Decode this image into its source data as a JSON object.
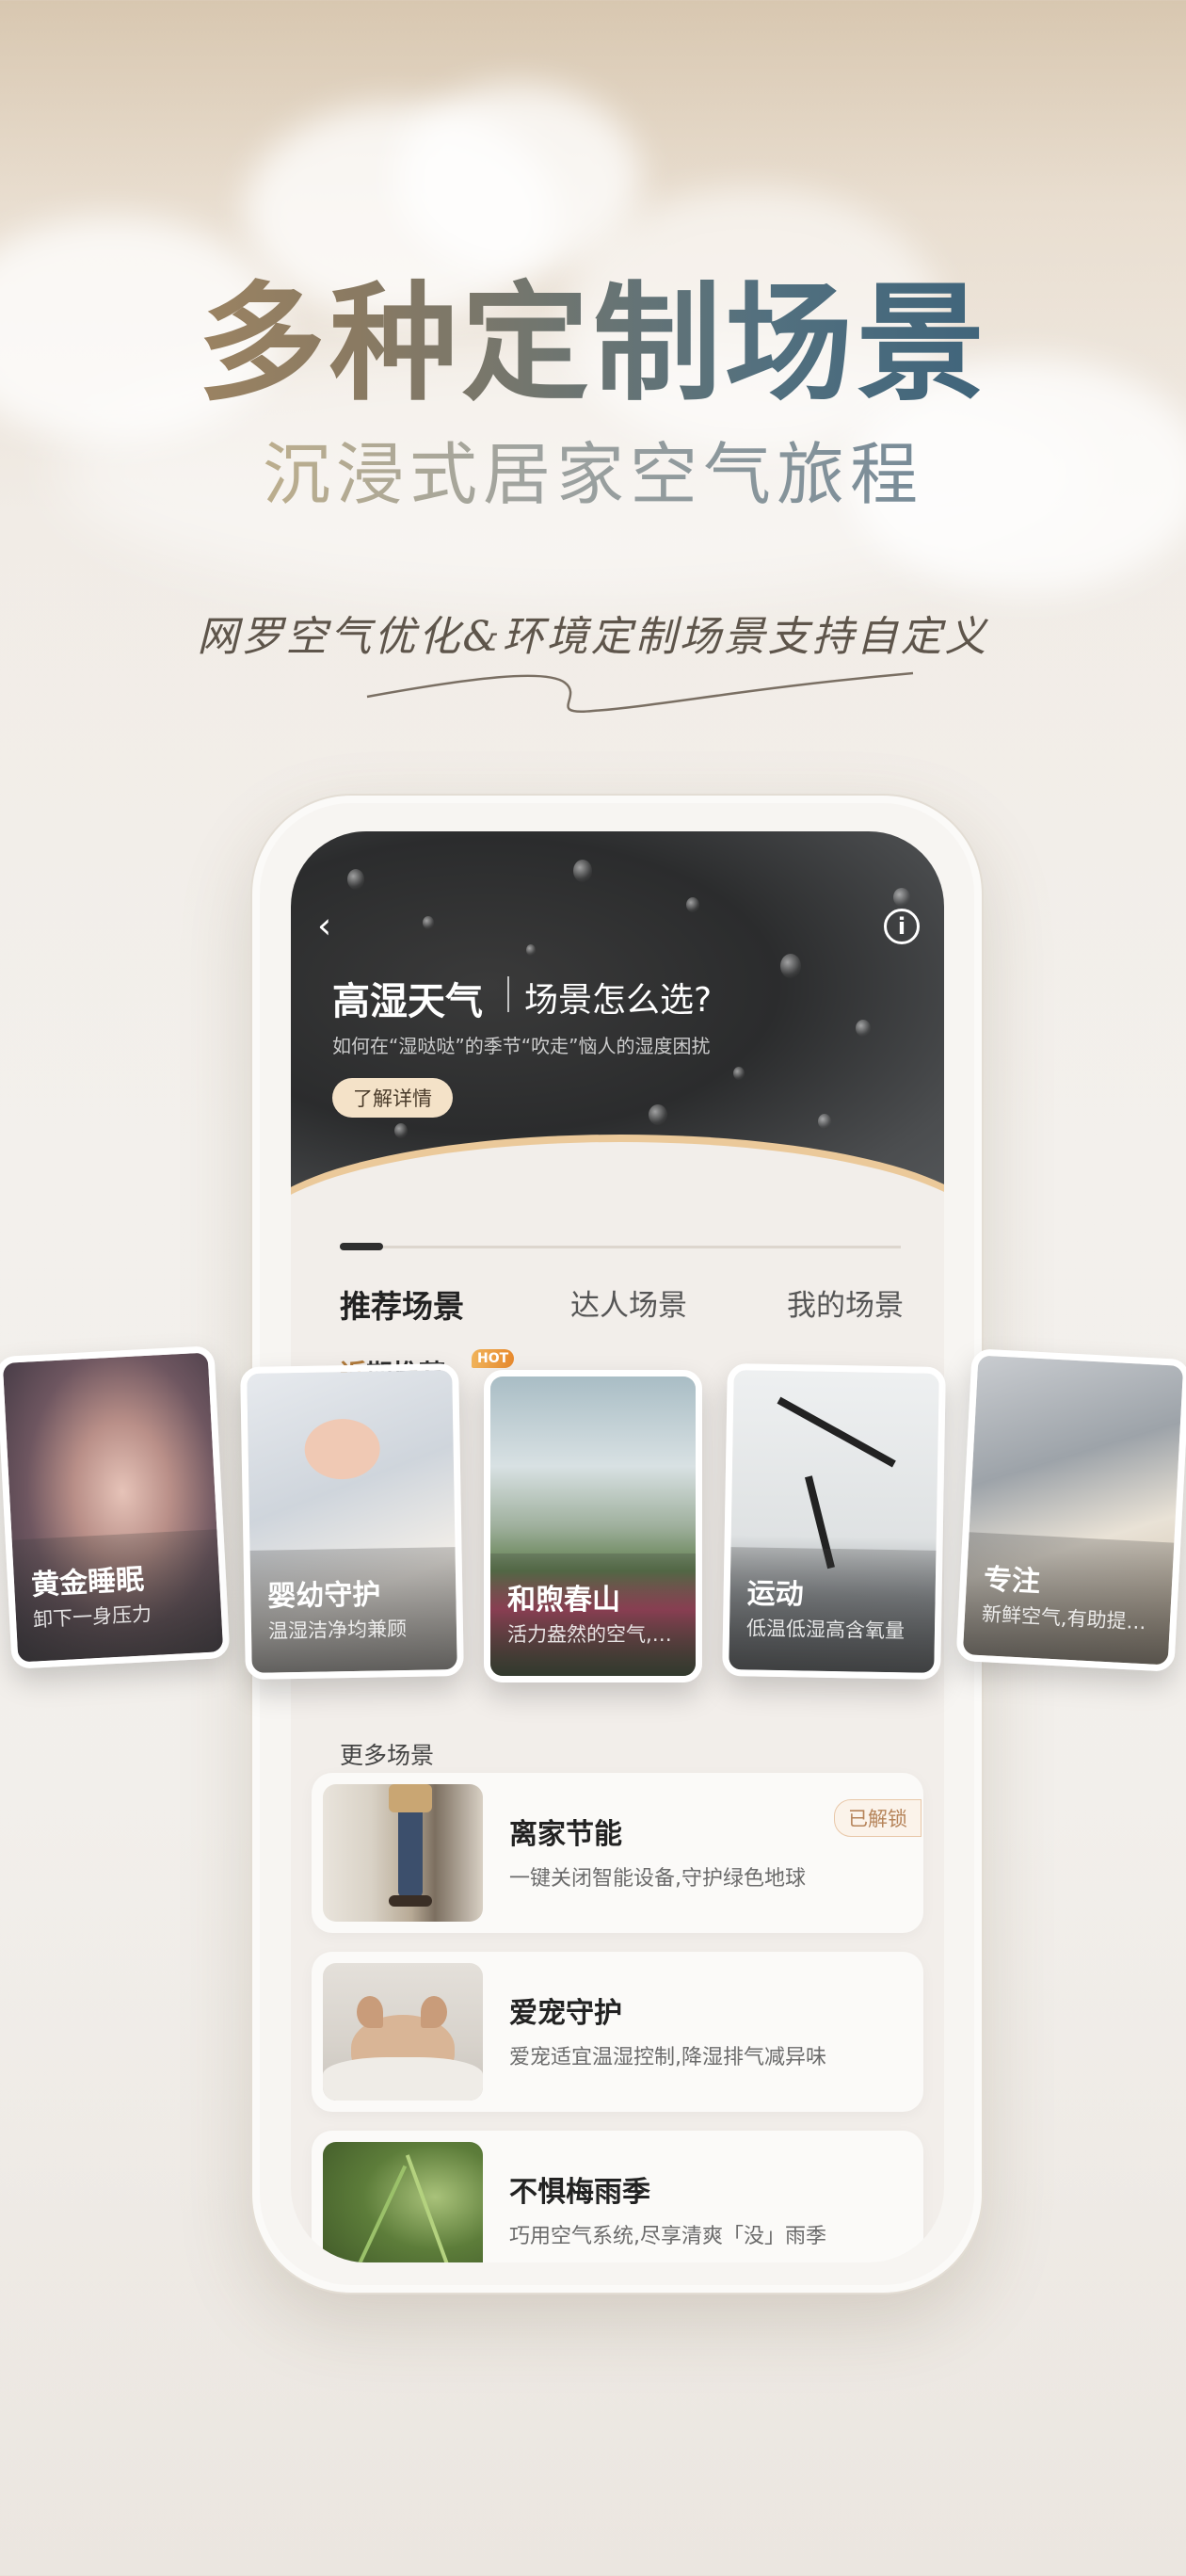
{
  "hero": {
    "title": "多种定制场景",
    "subtitle": "沉浸式居家空气旅程",
    "script": "网罗空气优化&环境定制场景支持自定义"
  },
  "banner": {
    "back_icon": "chevron-left-icon",
    "info_icon": "info-icon",
    "title": "高湿天气",
    "question": "场景怎么选?",
    "description": "如何在“湿哒哒”的季节“吹走”恼人的湿度困扰",
    "cta": "了解详情"
  },
  "tabs": [
    {
      "label": "推荐场景",
      "active": true
    },
    {
      "label": "达人场景",
      "active": false
    },
    {
      "label": "我的场景",
      "active": false
    }
  ],
  "recent": {
    "title_first": "近",
    "title_rest": "期推荐",
    "badge": "HOT"
  },
  "scenes": [
    {
      "title": "黄金睡眠",
      "desc": "卸下一身压力"
    },
    {
      "title": "婴幼守护",
      "desc": "温湿洁净均兼顾"
    },
    {
      "title": "和煦春山",
      "desc": "活力盎然的空气,和..."
    },
    {
      "title": "运动",
      "desc": "低温低湿高含氧量"
    },
    {
      "title": "专注",
      "desc": "新鲜空气,有助提升..."
    }
  ],
  "more": {
    "title": "更多场景",
    "items": [
      {
        "title": "离家节能",
        "desc": "一键关闭智能设备,守护绿色地球",
        "badge": "已解锁"
      },
      {
        "title": "爱宠守护",
        "desc": "爱宠适宜温湿控制,降湿排气减异味",
        "badge": ""
      },
      {
        "title": "不惧梅雨季",
        "desc": "巧用空气系统,尽享清爽「没」雨季",
        "badge": ""
      }
    ]
  },
  "colors": {
    "accent_gold": "#b07a3b",
    "unlock_text": "#b6845a",
    "cta_bg": "#f4e2c8"
  }
}
